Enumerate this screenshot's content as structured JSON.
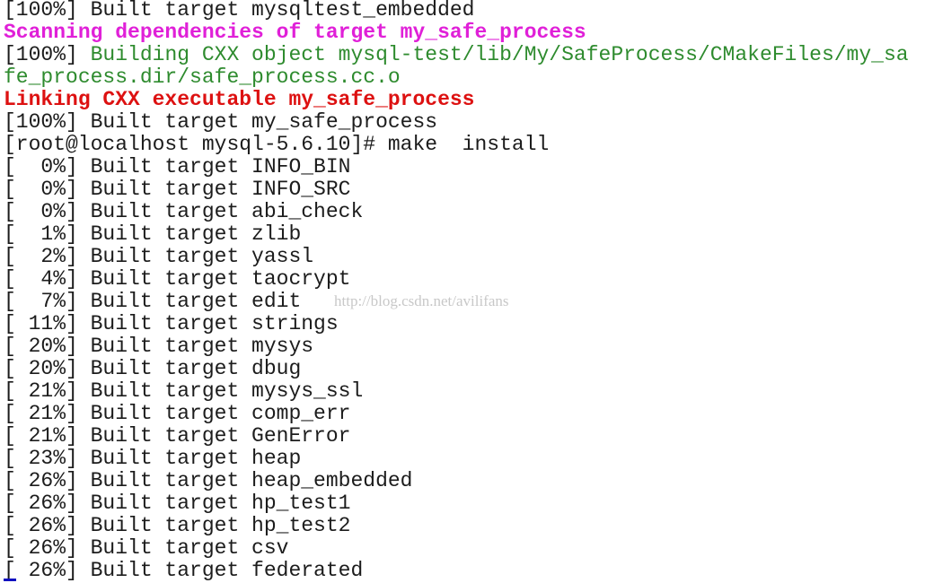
{
  "terminal": {
    "lines": [
      {
        "parts": [
          {
            "text": "[100%] Built target mysqltest_embedded",
            "style": "default"
          }
        ]
      },
      {
        "parts": [
          {
            "text": "Scanning dependencies of target my_safe_process",
            "style": "magenta"
          }
        ]
      },
      {
        "parts": [
          {
            "text": "[100%] ",
            "style": "default"
          },
          {
            "text": "Building CXX object mysql-test/lib/My/SafeProcess/CMakeFiles/my_sa",
            "style": "green"
          }
        ]
      },
      {
        "parts": [
          {
            "text": "fe_process.dir/safe_process.cc.o",
            "style": "green"
          }
        ]
      },
      {
        "parts": [
          {
            "text": "Linking CXX executable my_safe_process",
            "style": "red"
          }
        ]
      },
      {
        "parts": [
          {
            "text": "[100%] Built target my_safe_process",
            "style": "default"
          }
        ]
      },
      {
        "parts": [
          {
            "text": "[root@localhost mysql-5.6.10]# make  install",
            "style": "default"
          }
        ]
      },
      {
        "parts": [
          {
            "text": "[  0%] Built target INFO_BIN",
            "style": "default"
          }
        ]
      },
      {
        "parts": [
          {
            "text": "[  0%] Built target INFO_SRC",
            "style": "default"
          }
        ]
      },
      {
        "parts": [
          {
            "text": "[  0%] Built target abi_check",
            "style": "default"
          }
        ]
      },
      {
        "parts": [
          {
            "text": "[  1%] Built target zlib",
            "style": "default"
          }
        ]
      },
      {
        "parts": [
          {
            "text": "[  2%] Built target yassl",
            "style": "default"
          }
        ]
      },
      {
        "parts": [
          {
            "text": "[  4%] Built target taocrypt",
            "style": "default"
          }
        ]
      },
      {
        "parts": [
          {
            "text": "[  7%] Built target edit",
            "style": "default"
          }
        ]
      },
      {
        "parts": [
          {
            "text": "[ 11%] Built target strings",
            "style": "default"
          }
        ]
      },
      {
        "parts": [
          {
            "text": "[ 20%] Built target mysys",
            "style": "default"
          }
        ]
      },
      {
        "parts": [
          {
            "text": "[ 20%] Built target dbug",
            "style": "default"
          }
        ]
      },
      {
        "parts": [
          {
            "text": "[ 21%] Built target mysys_ssl",
            "style": "default"
          }
        ]
      },
      {
        "parts": [
          {
            "text": "[ 21%] Built target comp_err",
            "style": "default"
          }
        ]
      },
      {
        "parts": [
          {
            "text": "[ 21%] Built target GenError",
            "style": "default"
          }
        ]
      },
      {
        "parts": [
          {
            "text": "[ 23%] Built target heap",
            "style": "default"
          }
        ]
      },
      {
        "parts": [
          {
            "text": "[ 26%] Built target heap_embedded",
            "style": "default"
          }
        ]
      },
      {
        "parts": [
          {
            "text": "[ 26%] Built target hp_test1",
            "style": "default"
          }
        ]
      },
      {
        "parts": [
          {
            "text": "[ 26%] Built target hp_test2",
            "style": "default"
          }
        ]
      },
      {
        "parts": [
          {
            "text": "[ 26%] Built target csv",
            "style": "default"
          }
        ]
      },
      {
        "parts": [
          {
            "text": "[ 26%] Built target federated",
            "style": "default"
          }
        ]
      }
    ]
  },
  "watermark": "http://blog.csdn.net/avilifans",
  "colors": {
    "text": "#1c1c1c",
    "green": "#2e8b2e",
    "magenta": "#e020d8",
    "red": "#dd1111",
    "cursor": "#1010c0"
  }
}
